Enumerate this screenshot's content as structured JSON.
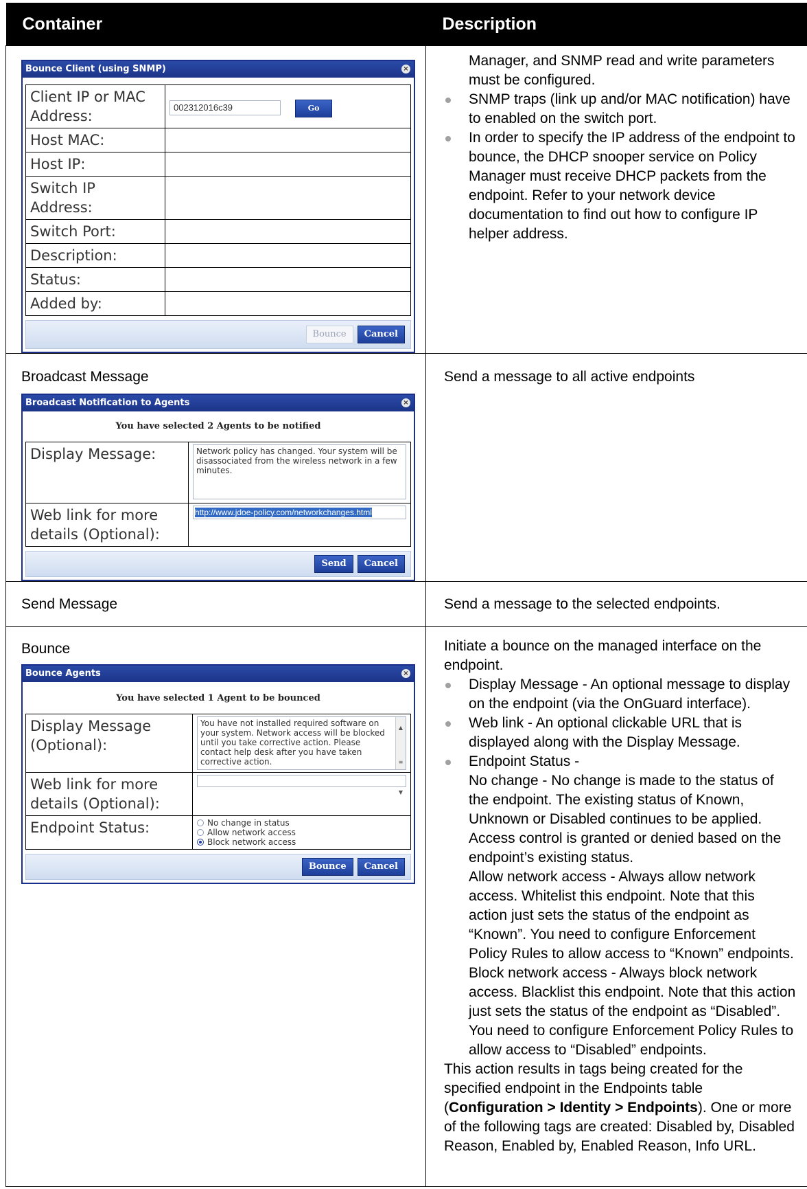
{
  "header": {
    "col1": "Container",
    "col2": "Description"
  },
  "row1": {
    "dialog": {
      "title": "Bounce Client (using SNMP)",
      "fields": [
        {
          "label": "Client IP or MAC Address:",
          "value": "002312016c39"
        },
        {
          "label": "Host MAC:"
        },
        {
          "label": "Host IP:"
        },
        {
          "label": "Switch IP Address:"
        },
        {
          "label": "Switch Port:"
        },
        {
          "label": "Description:"
        },
        {
          "label": "Status:"
        },
        {
          "label": "Added by:"
        }
      ],
      "go_label": "Go",
      "bounce_label": "Bounce",
      "cancel_label": "Cancel"
    },
    "desc_intro": "Manager, and SNMP read and write parameters must be configured.",
    "desc_bullets": [
      "SNMP traps (link up and/or MAC notification) have to enabled on the switch port.",
      "In order to specify the IP address of the endpoint to bounce, the DHCP snooper service on Policy Manager must receive DHCP packets from the endpoint. Refer to your network device documentation to find out how to configure IP helper address."
    ]
  },
  "row2": {
    "title": "Broadcast Message",
    "dialog": {
      "title": "Broadcast Notification to Agents",
      "notice": "You have selected 2 Agents to be notified",
      "display_label": "Display Message:",
      "display_value": "Network policy has changed. Your system will be disassociated from the wireless network in a few minutes.",
      "link_label": "Web link for more details (Optional):",
      "link_value": "http://www.jdoe-policy.com/networkchanges.html",
      "send_label": "Send",
      "cancel_label": "Cancel"
    },
    "desc": "Send a message to all active endpoints"
  },
  "row3": {
    "title": "Send Message",
    "desc": "Send a message to the selected endpoints."
  },
  "row4": {
    "title": "Bounce",
    "dialog": {
      "title": "Bounce Agents",
      "notice": "You have selected 1 Agent to be bounced",
      "display_label": "Display Message (Optional):",
      "display_value": "You have not installed required software on your system. Network access will be blocked until you take corrective action. Please contact help desk after you have taken corrective action.",
      "link_label": "Web link for more details (Optional):",
      "status_label": "Endpoint Status:",
      "options": [
        "No change in status",
        "Allow network access",
        "Block network access"
      ],
      "selected_option": "Block network access",
      "bounce_label": "Bounce",
      "cancel_label": "Cancel"
    },
    "desc_intro": "Initiate a bounce on the managed interface on the endpoint.",
    "desc_bullets": [
      "Display Message - An optional message to display on the endpoint (via the OnGuard interface).",
      "Web link - An optional clickable URL that is displayed along with the Display Message.",
      "Endpoint Status -"
    ],
    "status_details": [
      "No change - No change is made to the status of the endpoint. The existing status of Known, Unknown or Disabled continues to be applied. Access control is granted or denied based on the endpoint’s existing status.",
      "Allow network access - Always allow network access. Whitelist this endpoint. Note that this action just sets the status of the endpoint as “Known”. You need to configure Enforcement Policy Rules to allow access to “Known” endpoints.",
      "Block network access - Always block network access. Blacklist this endpoint. Note that this action just sets the status of the endpoint as “Disabled”. You need to configure Enforcement Policy Rules to allow access to “Disabled” endpoints."
    ],
    "closing_before": "This action results in tags being created for the specified endpoint in the Endpoints table (",
    "closing_path": "Configuration > Identity > Endpoints",
    "closing_after": "). One or more of the following tags are created: Disabled by, Disabled Reason, Enabled by, Enabled Reason, Info URL."
  }
}
